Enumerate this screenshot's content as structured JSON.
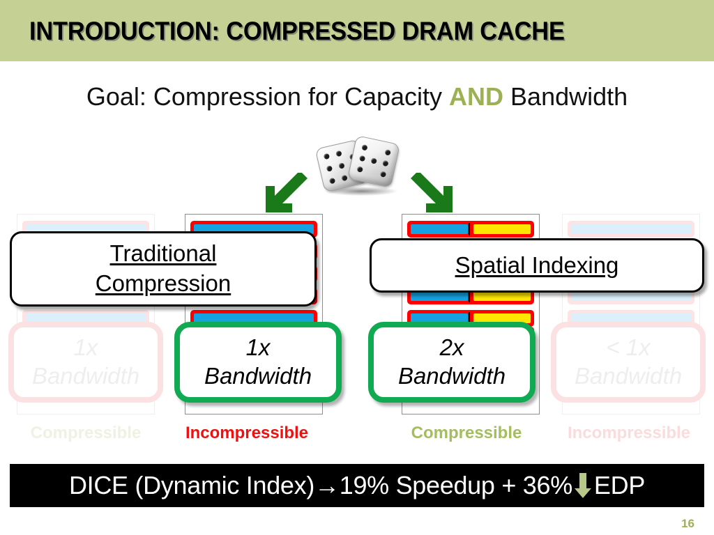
{
  "slide": {
    "title": "INTRODUCTION: COMPRESSED DRAM CACHE",
    "title_bar_color": "#C5D194",
    "page_number": "16"
  },
  "subtitle": {
    "before": "Goal: Compression for Capacity ",
    "highlight": "AND",
    "after": " Bandwidth",
    "highlight_color": "#9BB153"
  },
  "diagram": {
    "dice_icon": "two-dice-icon",
    "arrow_left_icon": "arrow-down-left-icon",
    "arrow_right_icon": "arrow-down-right-icon",
    "arrow_color": "#1a7a1a",
    "callouts": [
      {
        "id": "traditional-compression",
        "line1": "Traditional",
        "line2": "Compression"
      },
      {
        "id": "spatial-indexing",
        "line1": "Spatial Indexing",
        "line2": ""
      }
    ],
    "columns": [
      {
        "id": "col-1-ghost",
        "faded": true,
        "bandwidth_line1": "1x",
        "bandwidth_line2": "Bandwidth",
        "label": "Compressible",
        "label_color": "#eef2e3",
        "block_style": "blue-full"
      },
      {
        "id": "col-2-traditional-incompressible",
        "faded": false,
        "bandwidth_line1": "1x",
        "bandwidth_line2": "Bandwidth",
        "label": "Incompressible",
        "label_color": "#ee1111",
        "block_style": "blue-full"
      },
      {
        "id": "col-3-spatial-compressible",
        "faded": false,
        "bandwidth_line1": "2x",
        "bandwidth_line2": "Bandwidth",
        "label": "Compressible",
        "label_color": "#a3bd5f",
        "block_style": "blue-yellow-split"
      },
      {
        "id": "col-4-ghost",
        "faded": true,
        "bandwidth_line1": "< 1x",
        "bandwidth_line2": "Bandwidth",
        "label": "Incompressible",
        "label_color": "#fbdcdc",
        "block_style": "blue-full"
      }
    ],
    "colors": {
      "bar_border_red": "#FF0000",
      "segment_blue": "#14A3E0",
      "segment_yellow": "#FFE600",
      "green_callout_border": "#0FAA52"
    }
  },
  "footer": {
    "text_before": "DICE (Dynamic Index) ",
    "arrow_right": "→",
    "text_middle": " 19% Speedup + 36%",
    "down_arrow_icon": "arrow-down-icon",
    "text_after": "EDP",
    "bar_color": "#000000",
    "text_color": "#FFFFFF",
    "down_arrow_color": "#B6C98A"
  }
}
